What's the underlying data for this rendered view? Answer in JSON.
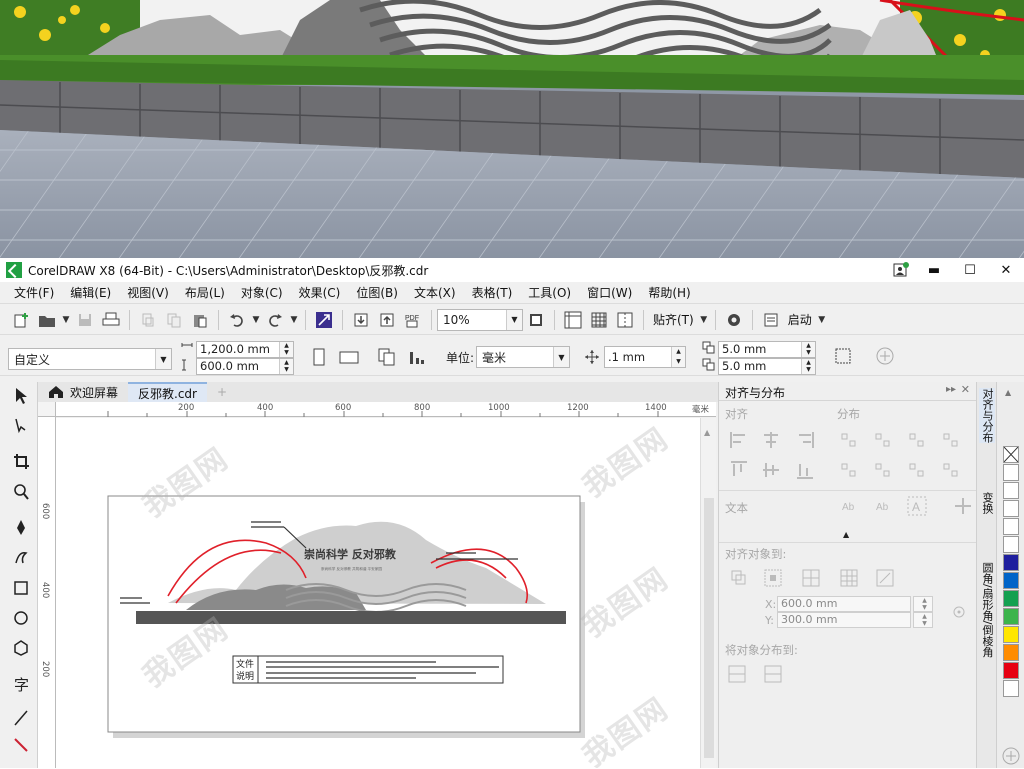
{
  "window": {
    "title": "CorelDRAW X8 (64-Bit) - C:\\Users\\Administrator\\Desktop\\反邪教.cdr",
    "minimize": "▬",
    "maximize": "☐",
    "close": "✕"
  },
  "menu": [
    "文件(F)",
    "编辑(E)",
    "视图(V)",
    "布局(L)",
    "对象(C)",
    "效果(C)",
    "位图(B)",
    "文本(X)",
    "表格(T)",
    "工具(O)",
    "窗口(W)",
    "帮助(H)"
  ],
  "toolbar": {
    "zoom": "10%",
    "snap_label": "贴齐(T)",
    "launch_label": "启动"
  },
  "propbar": {
    "page_preset": "自定义",
    "width": "1,200.0 mm",
    "height": "600.0 mm",
    "unit_label": "单位:",
    "unit": "毫米",
    "nudge": ".1 mm",
    "dup_x": "5.0 mm",
    "dup_y": "5.0 mm"
  },
  "tabs": {
    "welcome": "欢迎屏幕",
    "document": "反邪教.cdr",
    "add": "+"
  },
  "ruler": {
    "h_labels": [
      "200",
      "400",
      "600",
      "800",
      "1000",
      "1200",
      "1400"
    ],
    "h_unit": "毫米",
    "v_labels": [
      "600",
      "400",
      "200"
    ]
  },
  "design": {
    "slogan": "崇尚科学 反对邪教",
    "slogan_sub": "崇尚科学 反对邪教 共筑和谐 平安家园",
    "note_label_1": "文件",
    "note_label_2": "说明"
  },
  "docker": {
    "title": "对齐与分布",
    "align_label": "对齐",
    "distribute_label": "分布",
    "text_label": "文本",
    "align_to_label": "对齐对象到:",
    "x_label": "X:",
    "x_value": "600.0 mm",
    "y_label": "Y:",
    "y_value": "300.0 mm",
    "distribute_to_label": "将对象分布到:"
  },
  "side_tabs": [
    "对齐与分布",
    "变换",
    "圆角/扇形角/倒棱角"
  ],
  "palette": [
    "#ffffff",
    "#ffffff",
    "#ffffff",
    "#ffffff",
    "#ffffff",
    "#1f1f9e",
    "#0064c8",
    "#14a050",
    "#3cb44b",
    "#ffe600",
    "#ff8c00",
    "#e60012",
    "#ffffff"
  ],
  "watermark": "我图网"
}
